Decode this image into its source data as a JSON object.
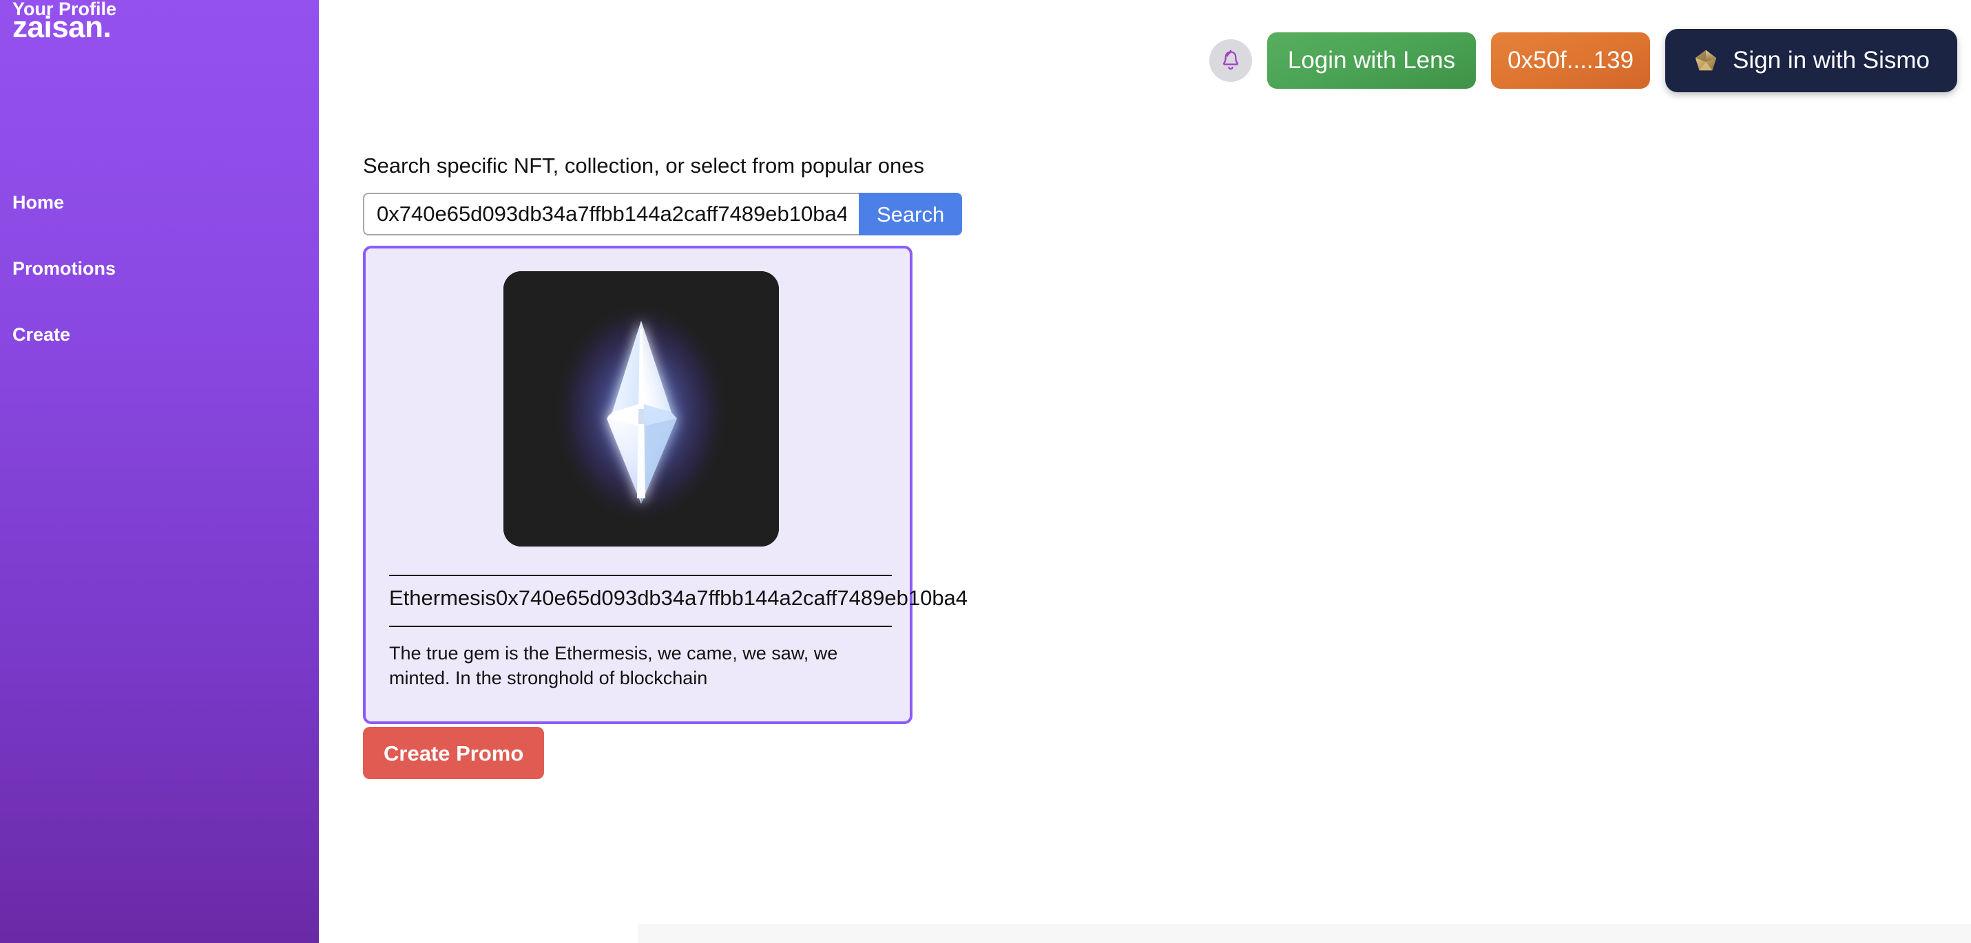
{
  "sidebar": {
    "brand": "zaisan.",
    "items": [
      {
        "label": "Home",
        "name": "home"
      },
      {
        "label": "Promotions",
        "name": "promotions"
      },
      {
        "label": "Create",
        "name": "create"
      },
      {
        "label": "Your Profile",
        "name": "your-profile"
      }
    ]
  },
  "topbar": {
    "bell_icon": "bell-icon",
    "lens_button_label": "Login with Lens",
    "wallet_button_label": "0x50f....139",
    "sismo_button_label": "Sign in with Sismo",
    "sismo_icon": "sismo-pentagon-gem-icon"
  },
  "search": {
    "label": "Search specific NFT, collection, or select from popular ones",
    "value": "0x740e65d093db34a7ffbb144a2caff7489eb10ba4",
    "placeholder": "",
    "button_label": "Search"
  },
  "nft_card": {
    "image_alt": "ethermesis-crystal-icon",
    "title": "Ethermesis0x740e65d093db34a7ffbb144a2caff7489eb10ba4",
    "description": "The true gem is the Ethermesis, we came, we saw, we minted. In the stronghold of blockchain"
  },
  "actions": {
    "create_promo_label": "Create Promo"
  },
  "colors": {
    "sidebar_top": "#9551ee",
    "sidebar_bottom": "#6a2aa6",
    "card_border": "#8b5cf6",
    "card_background": "#ede9fb",
    "search_button": "#4d7fe8",
    "lens_green": "#4ba354",
    "wallet_orange": "#dd7430",
    "sismo_navy": "#1c2444",
    "create_promo_red": "#e05b52",
    "bell_purple": "#a13fc4"
  }
}
